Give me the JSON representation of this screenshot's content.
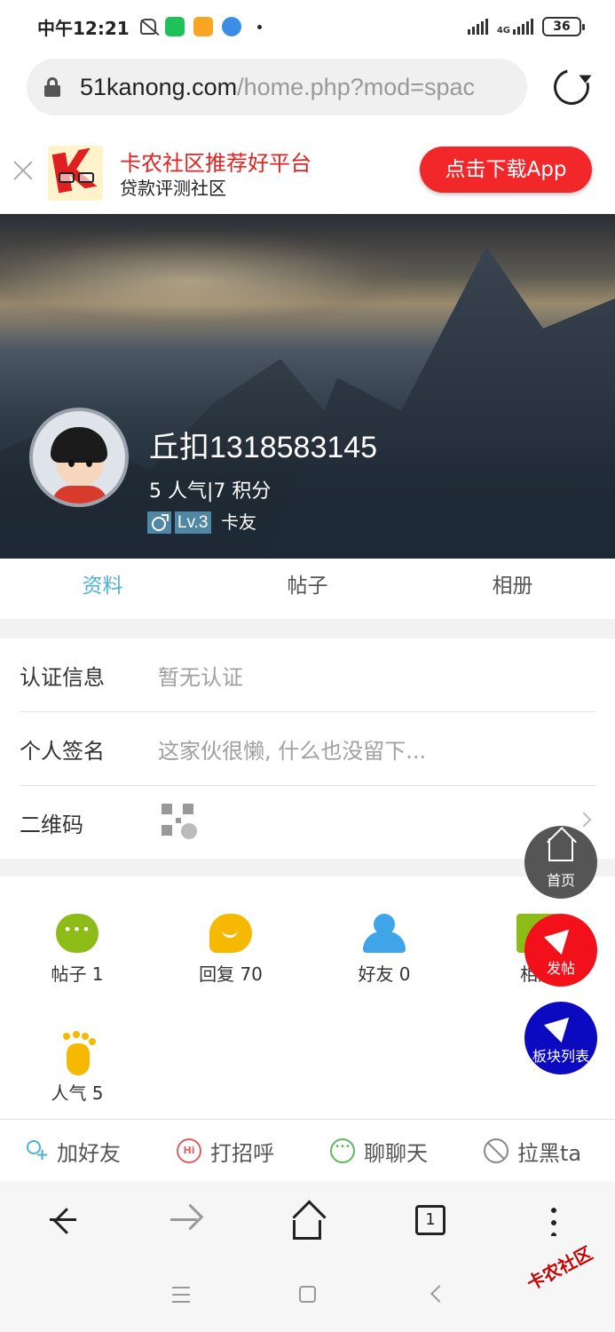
{
  "status_bar": {
    "time": "中午12:21",
    "network": "4G",
    "battery": "36"
  },
  "browser": {
    "url_host": "51kanong.com",
    "url_path": "/home.php?mod=spac"
  },
  "banner": {
    "title": "卡农社区推荐好平台",
    "subtitle": "贷款评测社区",
    "button": "点击下载App"
  },
  "profile": {
    "username": "丘扣1318583145",
    "stats": "5 人气|7 积分",
    "level": "Lv.3",
    "level_name": "卡友"
  },
  "tabs": [
    {
      "label": "资料",
      "active": true
    },
    {
      "label": "帖子",
      "active": false
    },
    {
      "label": "相册",
      "active": false
    }
  ],
  "info": {
    "cert": {
      "label": "认证信息",
      "value": "暂无认证"
    },
    "signature": {
      "label": "个人签名",
      "value": "这家伙很懒, 什么也没留下..."
    },
    "qrcode": {
      "label": "二维码"
    }
  },
  "stats": [
    {
      "label": "帖子 1",
      "icon": "chat-bubble-icon"
    },
    {
      "label": "回复 70",
      "icon": "reply-bubble-icon"
    },
    {
      "label": "好友 0",
      "icon": "friends-icon"
    },
    {
      "label": "相册",
      "icon": "album-icon"
    },
    {
      "label": "人气 5",
      "icon": "footprint-icon"
    }
  ],
  "fabs": {
    "home": "首页",
    "post": "发帖",
    "boards": "板块列表"
  },
  "actions": {
    "add_friend": "加好友",
    "greet": "打招呼",
    "chat": "聊聊天",
    "block": "拉黑ta"
  },
  "toolbar": {
    "tab_count": "1"
  },
  "watermark": "卡农社区",
  "colors": {
    "accent": "#4db0d8",
    "brand_red": "#f2272a",
    "fab_blue": "#0b0ac0"
  }
}
